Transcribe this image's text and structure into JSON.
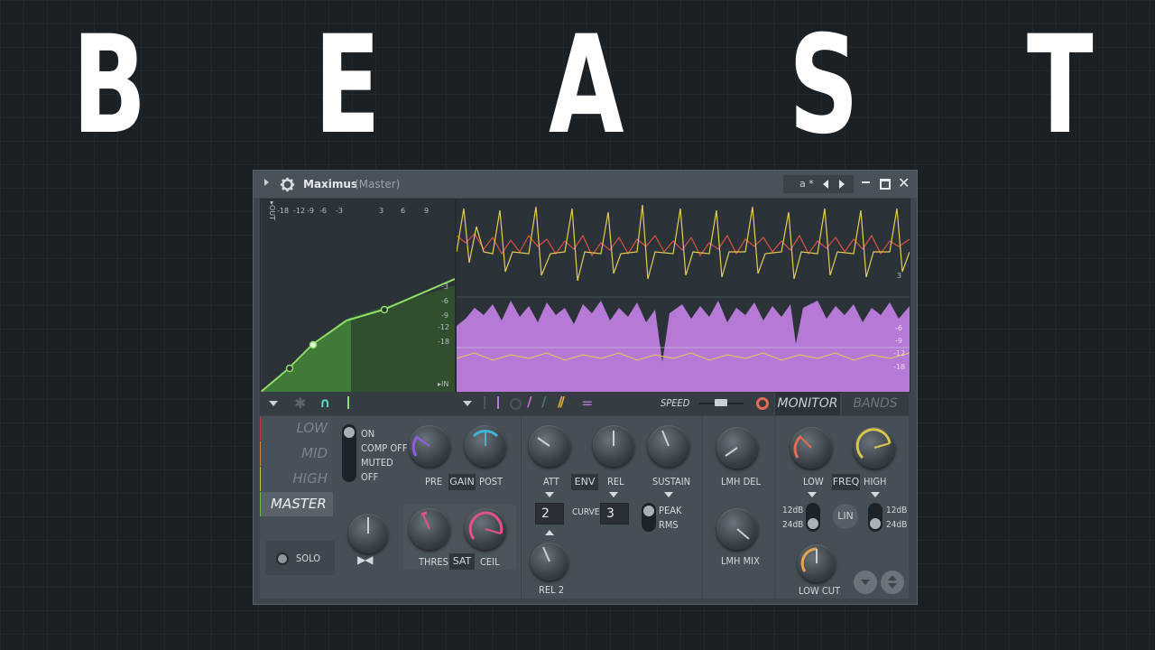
{
  "header": {
    "letters": [
      "B",
      "E",
      "A",
      "S",
      "T"
    ]
  },
  "window": {
    "title": "Maximus",
    "subtitle": "(Master)",
    "preset": "a *"
  },
  "graph": {
    "out_label": "▸OUT",
    "in_label": "▸IN",
    "top_ticks": [
      "-18",
      "-12",
      "-9",
      "-6",
      "-3",
      "3",
      "6",
      "9"
    ],
    "wave_ticks_top": [
      "9",
      "6",
      "3"
    ],
    "wave_ticks_mid": [
      "-3",
      "-6",
      "-9",
      "-12",
      "-18"
    ],
    "wave_ticks_right": [
      "-6",
      "-9",
      "-12",
      "-18"
    ]
  },
  "toolbar": {
    "speed_label": "SPEED"
  },
  "tabs": {
    "monitor": "MONITOR",
    "bands": "BANDS"
  },
  "bands": [
    "LOW",
    "MID",
    "HIGH",
    "MASTER"
  ],
  "band_colors": [
    "#c0393f",
    "#d08a3c",
    "#c8c245",
    "#6dbd45"
  ],
  "state": {
    "on": "ON",
    "comp_off": "COMP OFF",
    "muted": "MUTED",
    "off": "OFF"
  },
  "labels": {
    "pre": "PRE",
    "gain": "GAIN",
    "post": "POST",
    "att": "ATT",
    "env": "ENV",
    "rel": "REL",
    "sustain": "SUSTAIN",
    "lmh_del": "LMH DEL",
    "lmh_mix": "LMH MIX",
    "low": "LOW",
    "freq": "FREQ",
    "high": "HIGH",
    "thres": "THRES",
    "sat": "SAT",
    "ceil": "CEIL",
    "curve": "CURVE",
    "peak": "PEAK",
    "rms": "RMS",
    "rel2": "REL 2",
    "solo": "SOLO",
    "lin": "LIN",
    "low_cut": "LOW CUT",
    "db12": "12dB",
    "db24": "24dB",
    "db12b": "12dB",
    "db24b": "24dB"
  },
  "values": {
    "curve_left": "2",
    "curve_right": "3"
  },
  "colors": {
    "accent_green": "#8fe06a",
    "waveform_purple": "#b67ad6",
    "waveform_yellow": "#e6cc55",
    "waveform_red": "#d8533f"
  }
}
